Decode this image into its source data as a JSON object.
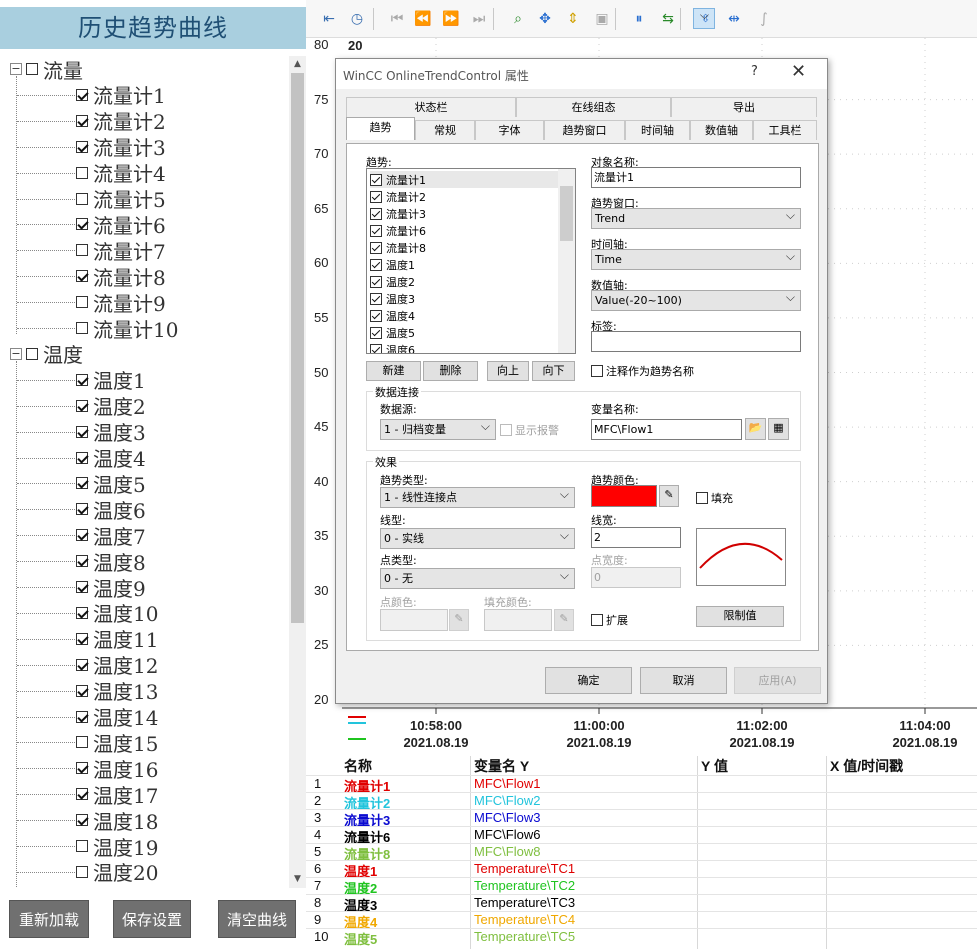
{
  "left_panel": {
    "title": "历史趋势曲线",
    "tree": [
      {
        "type": "group",
        "label": "流量"
      },
      {
        "type": "item",
        "label": "流量计1",
        "checked": true
      },
      {
        "type": "item",
        "label": "流量计2",
        "checked": true
      },
      {
        "type": "item",
        "label": "流量计3",
        "checked": true
      },
      {
        "type": "item",
        "label": "流量计4",
        "checked": false
      },
      {
        "type": "item",
        "label": "流量计5",
        "checked": false
      },
      {
        "type": "item",
        "label": "流量计6",
        "checked": true
      },
      {
        "type": "item",
        "label": "流量计7",
        "checked": false
      },
      {
        "type": "item",
        "label": "流量计8",
        "checked": true
      },
      {
        "type": "item",
        "label": "流量计9",
        "checked": false
      },
      {
        "type": "item",
        "label": "流量计10",
        "checked": false
      },
      {
        "type": "group",
        "label": "温度"
      },
      {
        "type": "item",
        "label": "温度1",
        "checked": true
      },
      {
        "type": "item",
        "label": "温度2",
        "checked": true
      },
      {
        "type": "item",
        "label": "温度3",
        "checked": true
      },
      {
        "type": "item",
        "label": "温度4",
        "checked": true
      },
      {
        "type": "item",
        "label": "温度5",
        "checked": true
      },
      {
        "type": "item",
        "label": "温度6",
        "checked": true
      },
      {
        "type": "item",
        "label": "温度7",
        "checked": true
      },
      {
        "type": "item",
        "label": "温度8",
        "checked": true
      },
      {
        "type": "item",
        "label": "温度9",
        "checked": true
      },
      {
        "type": "item",
        "label": "温度10",
        "checked": true
      },
      {
        "type": "item",
        "label": "温度11",
        "checked": true
      },
      {
        "type": "item",
        "label": "温度12",
        "checked": true
      },
      {
        "type": "item",
        "label": "温度13",
        "checked": true
      },
      {
        "type": "item",
        "label": "温度14",
        "checked": true
      },
      {
        "type": "item",
        "label": "温度15",
        "checked": false
      },
      {
        "type": "item",
        "label": "温度16",
        "checked": true
      },
      {
        "type": "item",
        "label": "温度17",
        "checked": true
      },
      {
        "type": "item",
        "label": "温度18",
        "checked": true
      },
      {
        "type": "item",
        "label": "温度19",
        "checked": false
      },
      {
        "type": "item",
        "label": "温度20",
        "checked": false
      }
    ],
    "buttons": {
      "reload": "重新加载",
      "save": "保存设置",
      "clear": "清空曲线"
    }
  },
  "toolbar": {
    "icons": [
      "first-page-icon",
      "clock-icon",
      "skip-first-icon",
      "rewind-icon",
      "forward-icon",
      "skip-last-icon",
      "zoom-icon",
      "move-icon",
      "value-axis-zoom-icon",
      "fit-icon",
      "stop-icon",
      "compare-icon",
      "ruler-icon",
      "select-range-icon",
      "statistics-icon"
    ]
  },
  "chart": {
    "y_ticks": [
      "80",
      "75",
      "70",
      "65",
      "60",
      "55",
      "50",
      "45",
      "40",
      "35",
      "30",
      "25",
      "20"
    ],
    "top_value": "20",
    "x_ticks": [
      {
        "time": "10:58:00",
        "date": "2021.08.19"
      },
      {
        "time": "11:00:00",
        "date": "2021.08.19"
      },
      {
        "time": "11:02:00",
        "date": "2021.08.19"
      },
      {
        "time": "11:04:00",
        "date": "2021.08.19"
      }
    ]
  },
  "table": {
    "headers": {
      "name": "名称",
      "var": "变量名 Y",
      "yval": "Y 值",
      "xval": "X 值/时间戳"
    },
    "rows": [
      {
        "n": "1",
        "name": "流量计1",
        "var": "MFC\\Flow1",
        "color": "#e00000"
      },
      {
        "n": "2",
        "name": "流量计2",
        "var": "MFC\\Flow2",
        "color": "#22c4dc"
      },
      {
        "n": "3",
        "name": "流量计3",
        "var": "MFC\\Flow3",
        "color": "#0a0ad0"
      },
      {
        "n": "4",
        "name": "流量计6",
        "var": "MFC\\Flow6",
        "color": "#000000"
      },
      {
        "n": "5",
        "name": "流量计8",
        "var": "MFC\\Flow8",
        "color": "#7fbf3f"
      },
      {
        "n": "6",
        "name": "温度1",
        "var": "Temperature\\TC1",
        "color": "#e00000"
      },
      {
        "n": "7",
        "name": "温度2",
        "var": "Temperature\\TC2",
        "color": "#1fc41f"
      },
      {
        "n": "8",
        "name": "温度3",
        "var": "Temperature\\TC3",
        "color": "#000000"
      },
      {
        "n": "9",
        "name": "温度4",
        "var": "Temperature\\TC4",
        "color": "#f0a800"
      },
      {
        "n": "10",
        "name": "温度5",
        "var": "Temperature\\TC5",
        "color": "#7fbf3f"
      }
    ]
  },
  "dialog": {
    "title": "WinCC OnlineTrendControl 属性",
    "help": "?",
    "close": "✕",
    "tabs_row1": [
      "状态栏",
      "在线组态",
      "导出"
    ],
    "tabs_row2": [
      "趋势",
      "常规",
      "字体",
      "趋势窗口",
      "时间轴",
      "数值轴",
      "工具栏"
    ],
    "active_tab": "趋势",
    "trend_label": "趋势:",
    "trend_list": [
      {
        "label": "流量计1",
        "checked": true
      },
      {
        "label": "流量计2",
        "checked": true
      },
      {
        "label": "流量计3",
        "checked": true
      },
      {
        "label": "流量计6",
        "checked": true
      },
      {
        "label": "流量计8",
        "checked": true
      },
      {
        "label": "温度1",
        "checked": true
      },
      {
        "label": "温度2",
        "checked": true
      },
      {
        "label": "温度3",
        "checked": true
      },
      {
        "label": "温度4",
        "checked": true
      },
      {
        "label": "温度5",
        "checked": true
      },
      {
        "label": "温度6",
        "checked": true
      }
    ],
    "list_buttons": {
      "new": "新建",
      "delete": "删除",
      "up": "向上",
      "down": "向下"
    },
    "object_name_label": "对象名称:",
    "object_name": "流量计1",
    "trend_window_label": "趋势窗口:",
    "trend_window": "Trend",
    "time_axis_label": "时间轴:",
    "time_axis": "Time",
    "value_axis_label": "数值轴:",
    "value_axis": "Value(-20~100)",
    "tag_label": "标签:",
    "tag_value": "",
    "comment_as_name": "注释作为趋势名称",
    "data_group": "数据连接",
    "datasource_label": "数据源:",
    "datasource": "1 - 归档变量",
    "show_alarm": "显示报警",
    "varname_label": "变量名称:",
    "varname": "MFC\\Flow1",
    "effect_group": "效果",
    "trend_type_label": "趋势类型:",
    "trend_type": "1 - 线性连接点",
    "line_type_label": "线型:",
    "line_type": "0 - 实线",
    "point_type_label": "点类型:",
    "point_type": "0 - 无",
    "point_color_label": "点颜色:",
    "fill_color_label": "填充颜色:",
    "trend_color_label": "趋势颜色:",
    "trend_color": "#ff0000",
    "fill_label": "填充",
    "line_width_label": "线宽:",
    "line_width": "2",
    "point_width_label": "点宽度:",
    "point_width": "0",
    "extend_label": "扩展",
    "limits_button": "限制值",
    "ok": "确定",
    "cancel": "取消",
    "apply": "应用(A)"
  }
}
